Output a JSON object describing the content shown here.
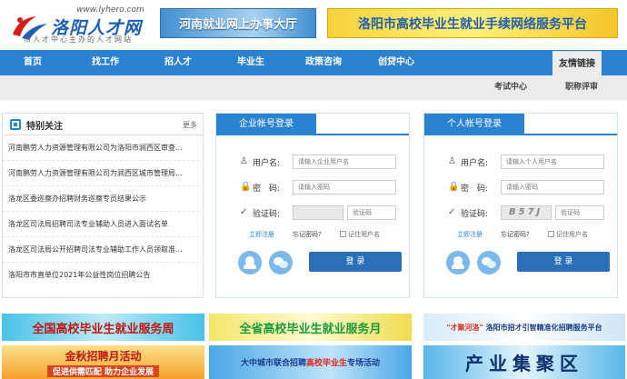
{
  "header": {
    "site_url": "www.lyhero.com",
    "site_name": "洛阳人才网",
    "site_slogan": "市人才中心主办的人才网站",
    "banner_left": "河南就业网上办事大厅",
    "banner_right": "洛阳市高校毕业生就业手续网络服务平台"
  },
  "nav": {
    "items": [
      "首页",
      "找工作",
      "招人才",
      "毕业生",
      "政策咨询",
      "创贷中心"
    ],
    "active": "友情链接",
    "sub_items": [
      "考试中心",
      "职称评审"
    ]
  },
  "notices": {
    "title": "特别关注",
    "more": "更多",
    "items": [
      "河南鹏劳人力资源管理有限公司为洛阳市涧西区审查...",
      "河南鹏劳人力资源管理有限公司为涧西区城市管理局...",
      "洛龙区委巡察办招聘财务巡察专员结果公示",
      "洛龙区司法局招聘司法专业辅助人员进入面试名单",
      "洛龙区司法局公开招聘司法专业辅助工作人员领取准...",
      "洛阳市市直单位2021年公益性岗位招聘公告"
    ]
  },
  "company_login": {
    "tab": "企业帐号登录",
    "username_label": "用户名:",
    "username_placeholder": "请输入企业用户名",
    "password_label": "密　码:",
    "password_placeholder": "请输入密码",
    "captcha_label": "验证码:",
    "captcha_placeholder": "验证码",
    "captcha_text": "",
    "register": "立即注册",
    "forgot": "忘记密码?",
    "remember": "记住用户名",
    "login_button": "登  录"
  },
  "personal_login": {
    "tab": "个人帐号登录",
    "username_label": "用户名:",
    "username_placeholder": "请输入个人用户名",
    "password_label": "密　码:",
    "password_placeholder": "请输入密码",
    "captcha_label": "验证码:",
    "captcha_placeholder": "验证码",
    "captcha_text": "B57J",
    "register": "立即注册",
    "forgot": "忘记密码?",
    "remember": "记住用户名",
    "login_button": "登  录"
  },
  "banners": {
    "b1": "全国高校毕业生就业服务周",
    "b2": "全省高校毕业生就业服务月",
    "b3_highlight": "\"才聚河洛\"",
    "b3": "洛阳市招才引智精准化招聘服务平台",
    "b4_title": "金秋招聘月活动",
    "b4_sub": "促进供需匹配  助力企业发展",
    "b5_prefix": "大中城市联合招聘",
    "b5_highlight": "高校毕业生",
    "b5_suffix": "专场活动",
    "b6": "产业集聚区"
  }
}
